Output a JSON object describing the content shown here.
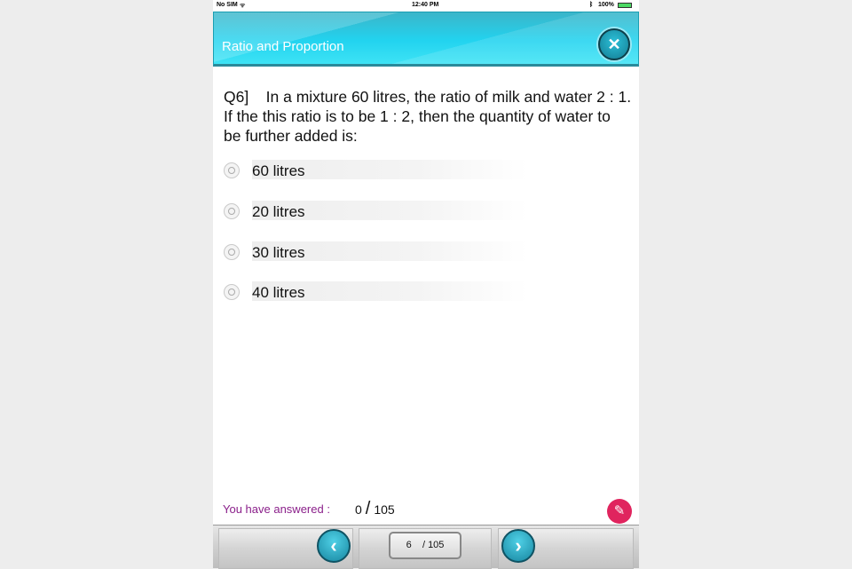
{
  "status_bar": {
    "carrier": "No SIM",
    "time": "12:40 PM",
    "battery": "100%"
  },
  "header": {
    "title": "Ratio and Proportion",
    "close_icon": "close-icon"
  },
  "question": {
    "text": "Q6]    In a mixture 60 litres, the ratio of milk and water 2 : 1. If the this ratio is to be 1 : 2, then the quantity of water to be further added is:"
  },
  "options": [
    {
      "label": "60 litres"
    },
    {
      "label": "20 litres"
    },
    {
      "label": "30 litres"
    },
    {
      "label": "40 litres"
    }
  ],
  "progress": {
    "label": "You have answered :",
    "answered": "0",
    "separator": "/",
    "total": "105"
  },
  "pager": {
    "current": "6",
    "separator": "/",
    "total": "105"
  },
  "colors": {
    "header": "#22d3ef",
    "answered_label": "#8a1f8a",
    "pencil": "#e0245e"
  }
}
